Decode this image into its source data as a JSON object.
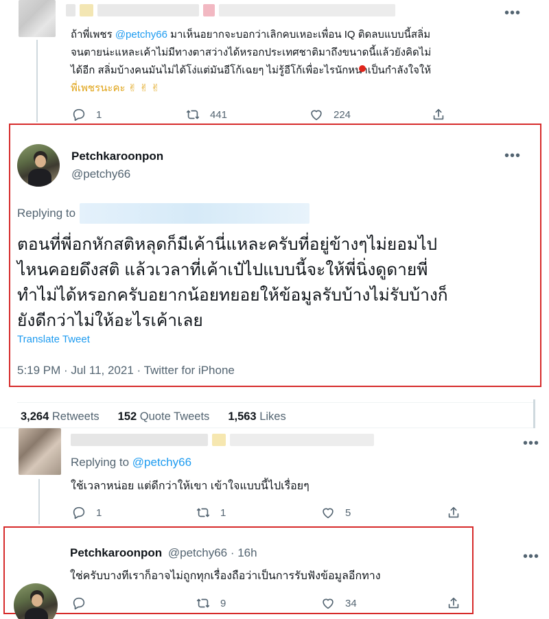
{
  "tweet_top": {
    "text_parts": [
      "ถ้าพี่เพชร ",
      "@petchy66",
      " มาเห็นอยากจะบอกว่าเลิกคบเหอะเพื่อน IQ ติดลบแบบนี้สลิ่ม",
      "จนตายน่ะแหละเค้าไม่มีทางตาสว่างได้หรอกประเทศชาติมาถึงขนาดนี้แล้วยังคิดไม่",
      "ได้อีก สลิ่มบ้างคนมันไม่ได้โง่แต่มันอีโก้เฉยๆ ไม่รู้อีโก้เพื่อะไรนักหนาเป็นกำลังใจให้",
      "พี่เพชรนะคะ ✌ ✌ ✌"
    ],
    "replies": "1",
    "retweets": "441",
    "likes": "224"
  },
  "main_tweet": {
    "display_name": "Petchkaroonpon",
    "handle": "@petchy66",
    "replying_to_label": "Replying to",
    "text_lines": [
      "ตอนที่พี่อกหักสติหลุดก็มีเค้านี่แหละครับที่อยู่ข้างๆไม่ยอมไป",
      "ไหนคอยดึงสติ แล้วเวลาที่เค้าเป๋ไปแบบนี้จะให้พี่นิ่งดูดายพี่",
      "ทำไม่ได้หรอกครับอยากน้อยทยอยให้ข้อมูลรับบ้างไม่รับบ้างก็",
      "ยังดีกว่าไม่ให้อะไรเค้าเลย"
    ],
    "translate_label": "Translate Tweet",
    "timestamp": "5:19 PM · Jul 11, 2021 · Twitter for iPhone"
  },
  "stats": {
    "retweets_count": "3,264",
    "retweets_label": "Retweets",
    "quotes_count": "152",
    "quotes_label": "Quote Tweets",
    "likes_count": "1,563",
    "likes_label": "Likes"
  },
  "reply_1": {
    "replying_to_label": "Replying to",
    "replying_to_handle": "@petchy66",
    "text": "ใช้เวลาหน่อย แต่ดีกว่าให้เขา เข้าใจแบบนี้ไปเรื่อยๆ",
    "replies": "1",
    "retweets": "1",
    "likes": "5"
  },
  "reply_2": {
    "display_name": "Petchkaroonpon",
    "handle_time": "@petchy66 · 16h",
    "text": "ใช่ครับบางทีเราก็อาจไม่ถูกทุกเรื่องถือว่าเป็นการรับฟังข้อมูลอีกทาง",
    "replies": "",
    "retweets": "9",
    "likes": "34"
  },
  "colors": {
    "accent": "#1d9bf0",
    "highlight_box": "#d62a2a",
    "secondary_text": "#536471"
  }
}
